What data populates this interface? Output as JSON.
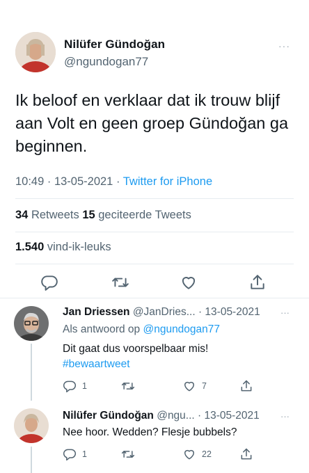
{
  "main": {
    "author_name": "Nilüfer Gündoğan",
    "author_handle": "@ngundogan77",
    "more": "···",
    "text": "Ik beloof en verklaar dat ik trouw blijf aan Volt en geen groep Gündoğan ga beginnen.",
    "time": "10:49 · 13-05-2021 · ",
    "client": "Twitter for iPhone",
    "retweets_count": "34",
    "retweets_label": " Retweets ",
    "quotes_count": "15",
    "quotes_label": " geciteerde Tweets",
    "likes_count": "1.540",
    "likes_label": " vind-ik-leuks",
    "icons": [
      "reply-icon",
      "retweet-icon",
      "like-icon",
      "share-icon"
    ]
  },
  "replies": [
    {
      "name": "Jan Driessen",
      "handle": "@JanDries...",
      "date": " · 13-05-2021",
      "more": "···",
      "reply_to_label": "Als antwoord op ",
      "reply_to_handle": "@ngundogan77",
      "text": "Dit gaat dus voorspelbaar mis!",
      "hashtag": "#bewaartweet",
      "reply_count": "1",
      "retweet_count": "",
      "like_count": "7"
    },
    {
      "name": "Nilüfer Gündoğan",
      "handle": "@ngu...",
      "date": " · 13-05-2021",
      "more": "···",
      "text": "Nee hoor. Wedden? Flesje bubbels?",
      "reply_count": "1",
      "retweet_count": "",
      "like_count": "22"
    }
  ],
  "colors": {
    "text": "#0f1419",
    "secondary": "#536471",
    "link": "#1d9bf0",
    "divider": "#e6ecf0",
    "thread_line": "#cfd9de"
  }
}
